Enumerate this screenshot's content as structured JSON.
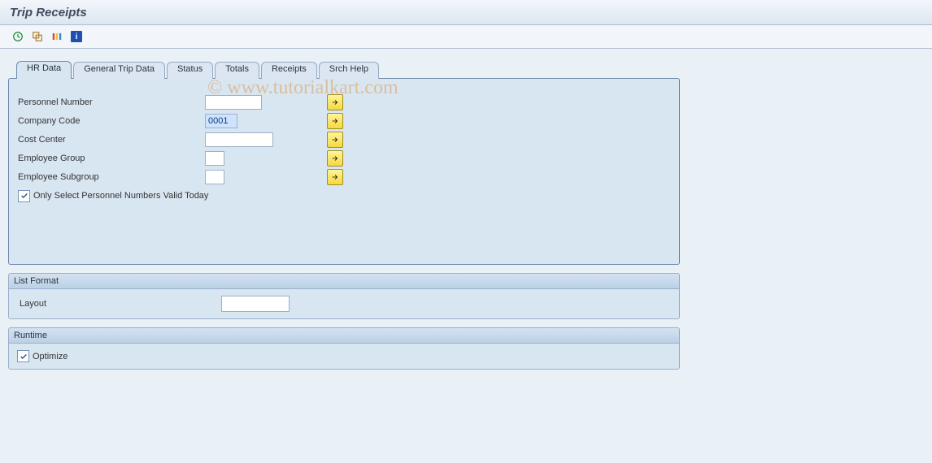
{
  "title": "Trip Receipts",
  "watermark": "© www.tutorialkart.com",
  "toolbar": {
    "execute_tip": "Execute",
    "new_tip": "Create",
    "variant_tip": "Get Variant",
    "info_tip": "Information"
  },
  "tabs": [
    {
      "label": "HR Data",
      "active": true
    },
    {
      "label": "General Trip Data",
      "active": false
    },
    {
      "label": "Status",
      "active": false
    },
    {
      "label": "Totals",
      "active": false
    },
    {
      "label": "Receipts",
      "active": false
    },
    {
      "label": "Srch Help",
      "active": false
    }
  ],
  "hr_data": {
    "personnel_number": {
      "label": "Personnel Number",
      "value": ""
    },
    "company_code": {
      "label": "Company Code",
      "value": "0001"
    },
    "cost_center": {
      "label": "Cost Center",
      "value": ""
    },
    "employee_group": {
      "label": "Employee Group",
      "value": ""
    },
    "employee_subgroup": {
      "label": "Employee Subgroup",
      "value": ""
    },
    "only_valid_today": {
      "label": "Only Select Personnel Numbers Valid Today",
      "checked": true
    }
  },
  "list_format": {
    "title": "List Format",
    "layout_label": "Layout",
    "layout_value": ""
  },
  "runtime": {
    "title": "Runtime",
    "optimize_label": "Optimize",
    "optimize_checked": true
  }
}
